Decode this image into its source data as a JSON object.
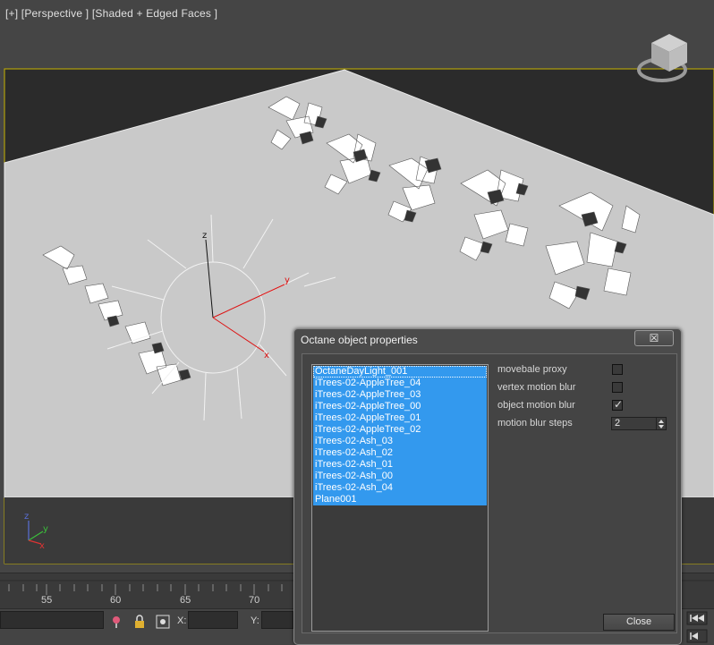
{
  "viewport": {
    "label": "[+] [Perspective ] [Shaded + Edged Faces ]",
    "colors": {
      "background": "#454545",
      "ground": "#c9c9c9",
      "sky": "#2b2b2b",
      "frame": "#c8b400"
    }
  },
  "timeline": {
    "ticks": [
      "55",
      "60",
      "65",
      "70"
    ]
  },
  "statusbar": {
    "x_label": "X:",
    "y_label": "Y:"
  },
  "dialog": {
    "title": "Octane object properties",
    "close_glyph": "☒",
    "objects": [
      "OctaneDayLight_001",
      "iTrees-02-AppleTree_04",
      "iTrees-02-AppleTree_03",
      "iTrees-02-AppleTree_00",
      "iTrees-02-AppleTree_01",
      "iTrees-02-AppleTree_02",
      "iTrees-02-Ash_03",
      "iTrees-02-Ash_02",
      "iTrees-02-Ash_01",
      "iTrees-02-Ash_00",
      "iTrees-02-Ash_04",
      "Plane001"
    ],
    "properties": {
      "movable_proxy": {
        "label": "movebale proxy",
        "checked": false
      },
      "vertex_motion_blur": {
        "label": "vertex motion blur",
        "checked": false
      },
      "object_motion_blur": {
        "label": "object motion blur",
        "checked": true
      },
      "motion_blur_steps": {
        "label": "motion blur steps",
        "value": "2"
      }
    },
    "close_label": "Close",
    "selection_color": "#3399ee"
  }
}
